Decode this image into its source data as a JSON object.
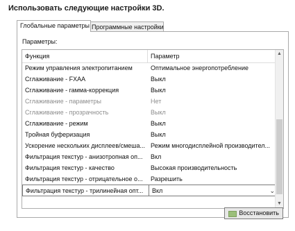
{
  "heading": "Использовать следующие настройки 3D.",
  "tabs": [
    {
      "label": "Глобальные параметры",
      "active": true
    },
    {
      "label": "Программные настройки",
      "active": false
    }
  ],
  "params_label": "Параметры:",
  "columns": {
    "function": "Функция",
    "parameter": "Параметр"
  },
  "rows": [
    {
      "function": "Режим управления электропитанием",
      "value": "Оптимальное энергопотребление",
      "disabled": false
    },
    {
      "function": "Сглаживание - FXAA",
      "value": "Выкл",
      "disabled": false
    },
    {
      "function": "Сглаживание - гамма-коррекция",
      "value": "Выкл",
      "disabled": false
    },
    {
      "function": "Сглаживание - параметры",
      "value": "Нет",
      "disabled": true
    },
    {
      "function": "Сглаживание - прозрачность",
      "value": "Выкл",
      "disabled": true
    },
    {
      "function": "Сглаживание - режим",
      "value": "Выкл",
      "disabled": false
    },
    {
      "function": "Тройная буферизация",
      "value": "Выкл",
      "disabled": false
    },
    {
      "function": "Ускорение нескольких дисплеев/смеша...",
      "value": "Режим многодисплейной производител...",
      "disabled": false
    },
    {
      "function": "Фильтрация текстур - анизотропная оп...",
      "value": "Вкл",
      "disabled": false
    },
    {
      "function": "Фильтрация текстур - качество",
      "value": "Высокая производительность",
      "disabled": false
    },
    {
      "function": "Фильтрация текстур - отрицательное о...",
      "value": "Разрешить",
      "disabled": false
    },
    {
      "function": "Фильтрация текстур - трилинейная опт...",
      "value": "Вкл",
      "disabled": false,
      "selected": true
    }
  ],
  "restore_button": "Восстановить",
  "colors": {
    "button_icon": "#9bbf7a"
  }
}
